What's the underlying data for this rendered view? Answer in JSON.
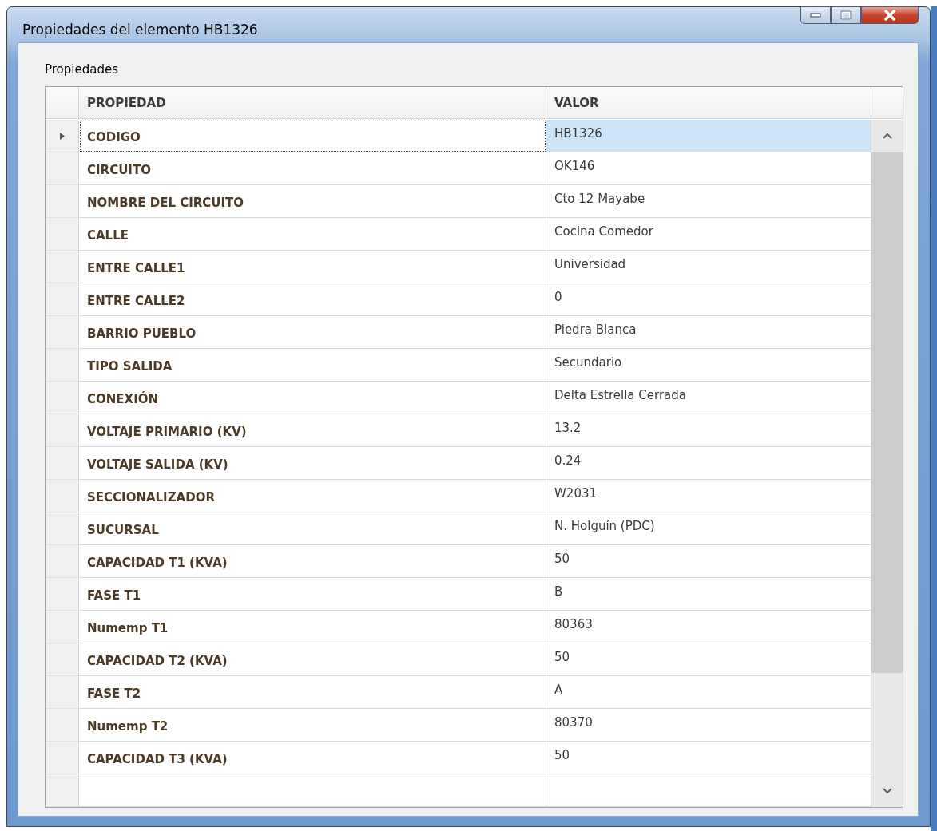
{
  "window": {
    "title": "Propiedades del elemento HB1326"
  },
  "group_label": "Propiedades",
  "table": {
    "columns": [
      "PROPIEDAD",
      "VALOR"
    ],
    "rows": [
      {
        "name": "CODIGO",
        "value": "HB1326",
        "selected": true
      },
      {
        "name": "CIRCUITO",
        "value": "OK146",
        "selected": false
      },
      {
        "name": "NOMBRE DEL CIRCUITO",
        "value": "Cto 12 Mayabe",
        "selected": false
      },
      {
        "name": "CALLE",
        "value": "Cocina Comedor",
        "selected": false
      },
      {
        "name": "ENTRE CALLE1",
        "value": "Universidad",
        "selected": false
      },
      {
        "name": "ENTRE CALLE2",
        "value": "0",
        "selected": false
      },
      {
        "name": "BARRIO PUEBLO",
        "value": "Piedra Blanca",
        "selected": false
      },
      {
        "name": "TIPO SALIDA",
        "value": "Secundario",
        "selected": false
      },
      {
        "name": "CONEXIÓN",
        "value": "Delta Estrella Cerrada",
        "selected": false
      },
      {
        "name": "VOLTAJE PRIMARIO (KV)",
        "value": "13.2",
        "selected": false
      },
      {
        "name": "VOLTAJE SALIDA (KV)",
        "value": "0.24",
        "selected": false
      },
      {
        "name": "SECCIONALIZADOR",
        "value": "W2031",
        "selected": false
      },
      {
        "name": "SUCURSAL",
        "value": "N. Holguín (PDC)",
        "selected": false
      },
      {
        "name": "CAPACIDAD T1 (KVA)",
        "value": "50",
        "selected": false
      },
      {
        "name": "FASE T1",
        "value": "B",
        "selected": false
      },
      {
        "name": "Numemp T1",
        "value": "80363",
        "selected": false
      },
      {
        "name": "CAPACIDAD T2 (KVA)",
        "value": "50",
        "selected": false
      },
      {
        "name": "FASE T2",
        "value": "A",
        "selected": false
      },
      {
        "name": "Numemp T2",
        "value": "80370",
        "selected": false
      },
      {
        "name": "CAPACIDAD T3 (KVA)",
        "value": "50",
        "selected": false
      }
    ]
  }
}
